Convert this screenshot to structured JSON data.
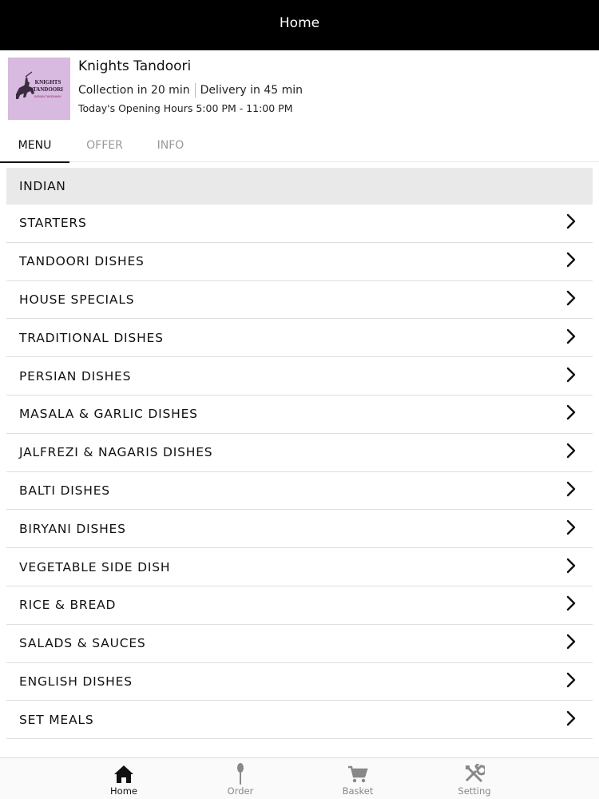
{
  "top_bar": {
    "title": "Home"
  },
  "restaurant": {
    "name": "Knights Tandoori",
    "logo_text_line1": "KNIGHTS",
    "logo_text_line2": "TANDOORI",
    "logo_text_line3": "INDIAN TAKEAWAY",
    "collection": "Collection in 20 min",
    "delivery": "Delivery in 45 min",
    "opening_hours": "Today's Opening Hours 5:00 PM - 11:00 PM"
  },
  "tabs": [
    {
      "label": "MENU",
      "active": true
    },
    {
      "label": "OFFER",
      "active": false
    },
    {
      "label": "INFO",
      "active": false
    }
  ],
  "menu": {
    "section_title": "INDIAN",
    "categories": [
      "STARTERS",
      "TANDOORI DISHES",
      "HOUSE SPECIALS",
      "TRADITIONAL DISHES",
      "PERSIAN DISHES",
      "MASALA & GARLIC DISHES",
      "JALFREZI & NAGARIS DISHES",
      "BALTI DISHES",
      "BIRYANI DISHES",
      "VEGETABLE SIDE DISH",
      "RICE & BREAD",
      "SALADS & SAUCES",
      "ENGLISH DISHES",
      "SET MEALS"
    ]
  },
  "bottom_nav": [
    {
      "label": "Home",
      "icon": "home-icon",
      "active": true
    },
    {
      "label": "Order",
      "icon": "spoon-icon",
      "active": false
    },
    {
      "label": "Basket",
      "icon": "cart-icon",
      "active": false
    },
    {
      "label": "Setting",
      "icon": "tools-icon",
      "active": false
    }
  ],
  "colors": {
    "top_bar_bg": "#000000",
    "section_bg": "#e9e9e9",
    "logo_bg": "#d8b9e0",
    "inactive": "#999999"
  }
}
